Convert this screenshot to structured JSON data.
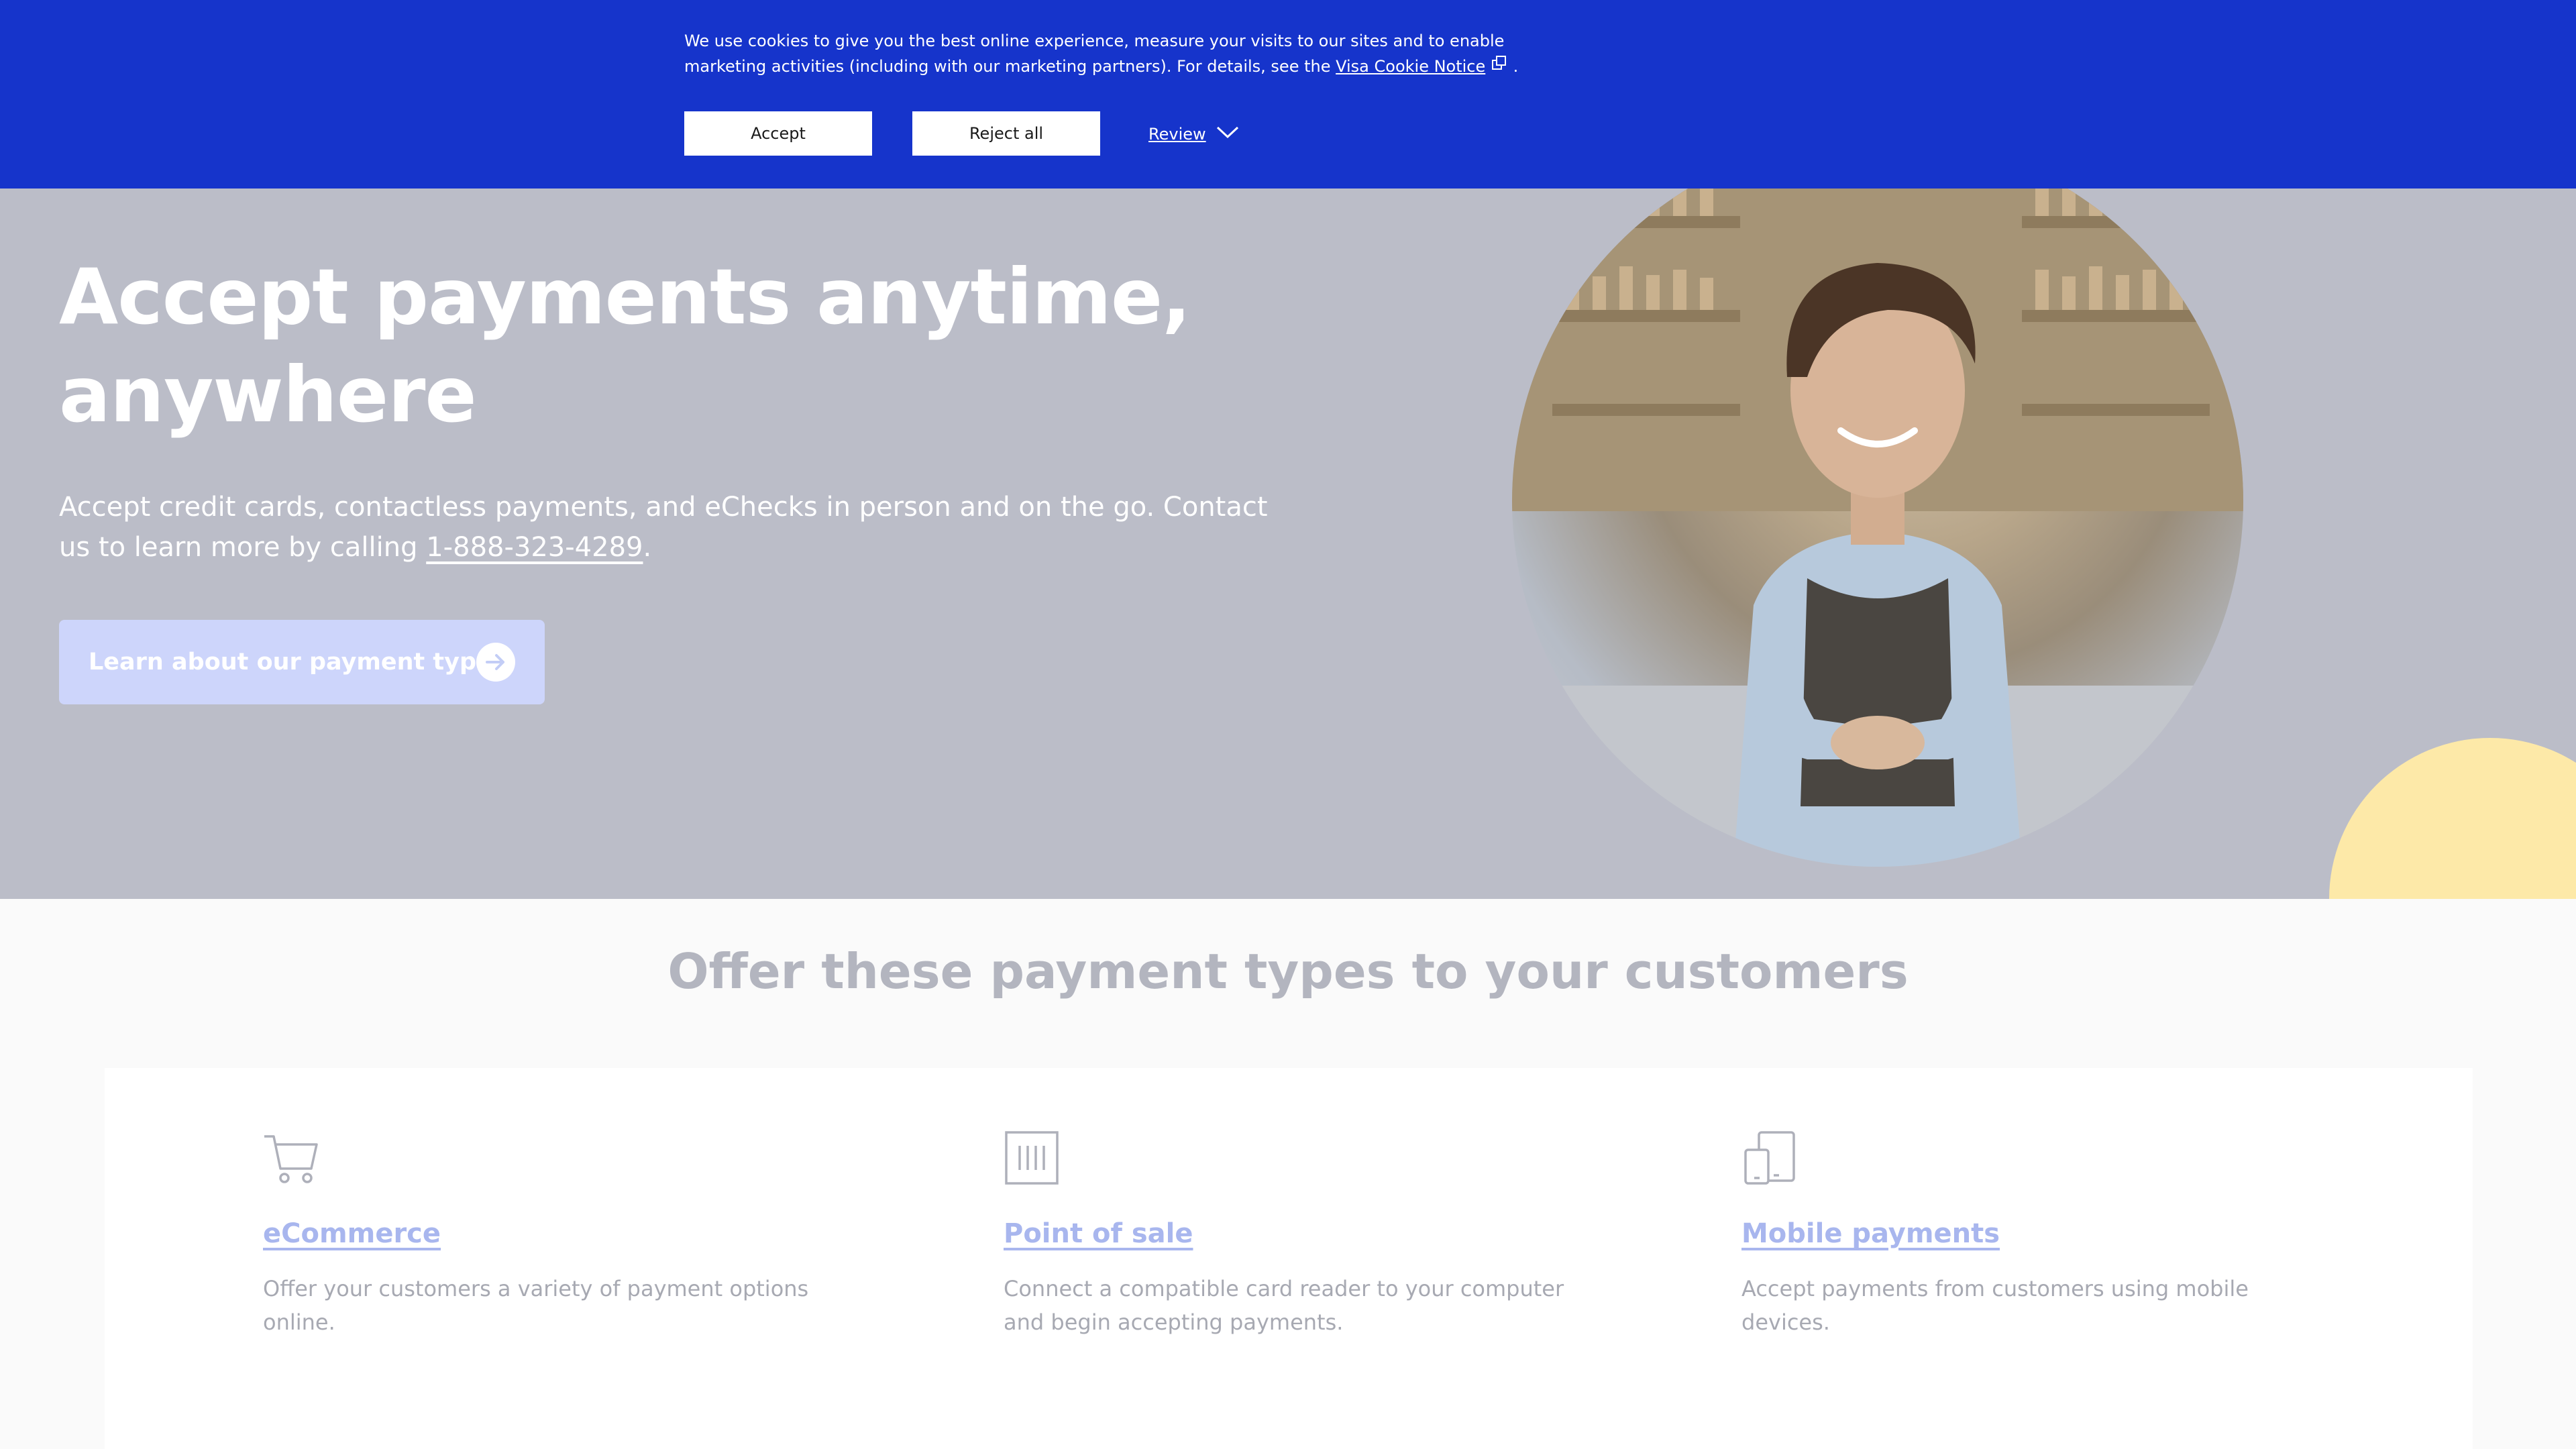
{
  "cookie_banner": {
    "text_before_link": "We use cookies to give you the best online experience, measure your visits to our sites and to enable marketing activities (including with our marketing partners). For details, see the ",
    "notice_link": "Visa Cookie Notice",
    "text_after_link": ".",
    "accept_label": "Accept",
    "reject_label": "Reject all",
    "review_label": "Review",
    "background_color": "#1634cb"
  },
  "hero": {
    "title": "Accept payments anytime, anywhere",
    "text_before_phone": "Accept credit cards, contactless payments, and eChecks in person and on the go. Contact us to learn more by calling ",
    "phone": "1-888-323-4289",
    "text_after_phone": ".",
    "cta_label": "Learn about our payment types",
    "cta_icon": "arrow-right-circle-icon"
  },
  "payment_types": {
    "title": "Offer these payment types to your customers",
    "items": [
      {
        "icon": "shopping-cart-icon",
        "title": "eCommerce",
        "description": "Offer your customers a variety of payment options online."
      },
      {
        "icon": "card-reader-icon",
        "title": "Point of sale",
        "description": "Connect a compatible card reader to your computer and begin accepting payments."
      },
      {
        "icon": "mobile-devices-icon",
        "title": "Mobile payments",
        "description": "Accept payments from customers using mobile devices."
      }
    ]
  }
}
